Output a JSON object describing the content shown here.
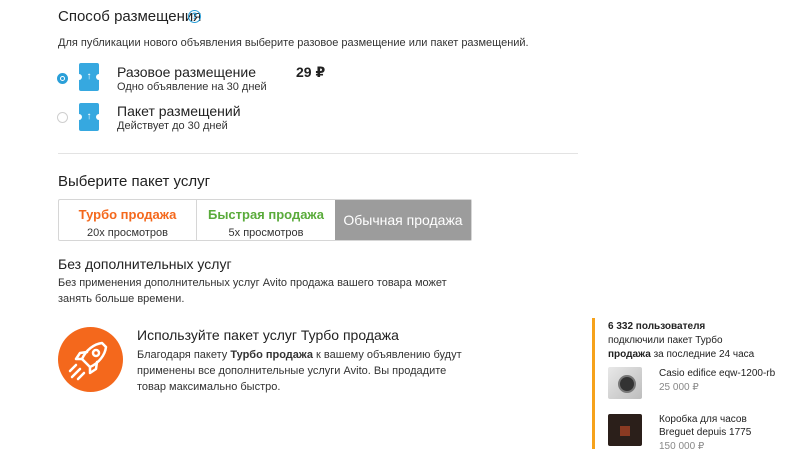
{
  "placement": {
    "title": "Способ размещения",
    "help_icon": "question-icon",
    "subtitle": "Для публикации нового объявления выберите разовое размещение или пакет размещений.",
    "options": [
      {
        "title": "Разовое размещение",
        "subtitle": "Одно объявление на 30 дней",
        "price": "29 ₽",
        "selected": true
      },
      {
        "title": "Пакет размещений",
        "subtitle": "Действует до 30 дней",
        "price": "",
        "selected": false
      }
    ]
  },
  "services": {
    "title": "Выберите пакет услуг",
    "packages": [
      {
        "name": "Турбо продажа",
        "views": "20x просмотров",
        "color": "#f4681c"
      },
      {
        "name": "Быстрая продажа",
        "views": "5x просмотров",
        "color": "#5aab3b"
      },
      {
        "name": "Обычная продажа",
        "views": "",
        "color": "#9c9c9c",
        "selected": true
      }
    ],
    "none_title": "Без дополнительных услуг",
    "none_desc": "Без применения дополнительных услуг Avito продажа вашего товара может занять больше времени."
  },
  "promo": {
    "icon": "rocket-icon",
    "title": "Используйте пакет услуг Турбо продажа",
    "text_before": "Благодаря пакету ",
    "text_bold": "Турбо продажа",
    "text_after": " к вашему объявлению будут применены все дополнительные услуги Avito. Вы продадите товар максимально быстро."
  },
  "sidebar": {
    "users_count": "6 332 пользователя",
    "line2": "подключили пакет Турбо",
    "line3_bold": "продажа",
    "line3_rest": " за последние 24 часа",
    "products": [
      {
        "name": "Casio edifice eqw-1200-rb",
        "price": "25 000 ₽"
      },
      {
        "name": "Коробка для часов Breguet depuis 1775",
        "price": "150 000 ₽"
      }
    ]
  }
}
